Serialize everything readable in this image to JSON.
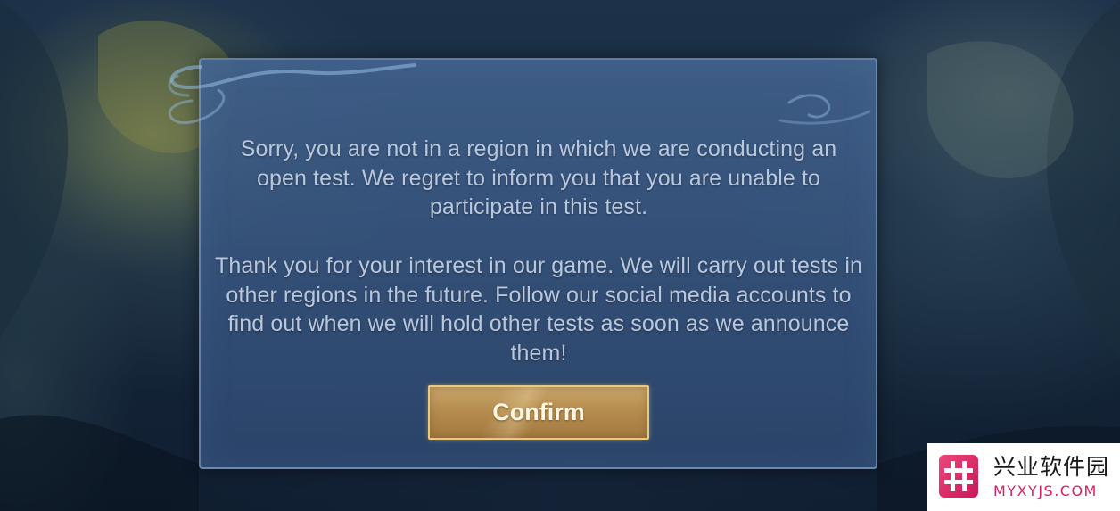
{
  "dialog": {
    "paragraphs": [
      "Sorry, you are not in a region in which we are conducting an open test. We regret to inform you that you are unable to participate in this test.",
      "Thank you for your interest in our game. We will carry out tests in other regions in the future. Follow our social media accounts to find out when we will hold other tests as soon as we announce them!"
    ],
    "confirm_label": "Confirm"
  },
  "watermark": {
    "name_cn": "兴业软件园",
    "name_en": "MYXYJS.COM",
    "icon": "hash-logo-icon"
  },
  "colors": {
    "dialog_text": "#b9c7dc",
    "button_gold": "#b68d4f",
    "watermark_pink": "#d6216a"
  }
}
